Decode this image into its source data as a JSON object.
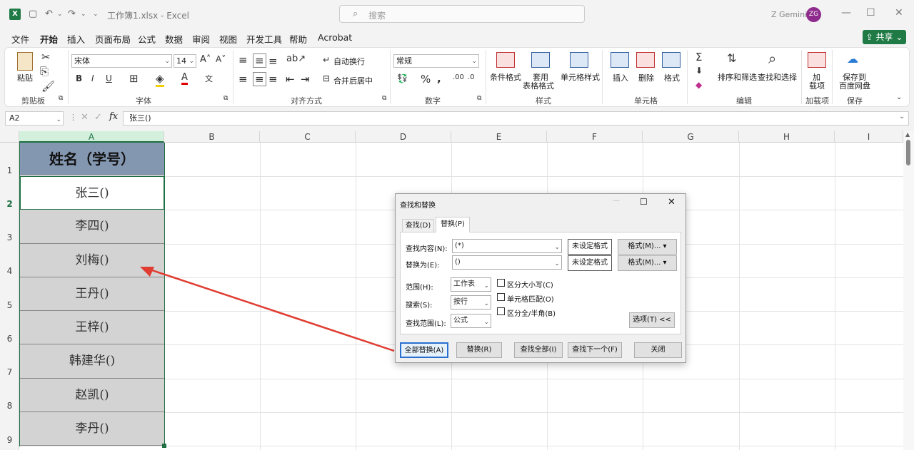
{
  "title_bar": {
    "file_title": "工作簿1.xlsx - Excel",
    "search_placeholder": "搜索",
    "user_name": "Z Gemini",
    "avatar_initials": "ZG"
  },
  "menu": {
    "items": [
      "文件",
      "开始",
      "插入",
      "页面布局",
      "公式",
      "数据",
      "审阅",
      "视图",
      "开发工具",
      "帮助",
      "Acrobat"
    ],
    "active": "开始",
    "share_label": "共享"
  },
  "ribbon": {
    "clipboard": {
      "paste": "粘贴",
      "label": "剪贴板"
    },
    "font": {
      "name": "宋体",
      "size": "14",
      "label": "字体"
    },
    "alignment": {
      "wrap": "自动换行",
      "merge": "合并后居中",
      "label": "对齐方式"
    },
    "number": {
      "format": "常规",
      "label": "数字"
    },
    "styles": {
      "conditional": "条件格式",
      "table_line1": "套用",
      "table_line2": "表格格式",
      "cell_styles": "单元格样式",
      "label": "样式"
    },
    "cells": {
      "insert": "插入",
      "delete": "删除",
      "format": "格式",
      "label": "单元格"
    },
    "editing": {
      "sort": "排序和筛选",
      "find": "查找和选择",
      "label": "编辑"
    },
    "addins": {
      "line1": "加",
      "line2": "载项",
      "label": "加载项"
    },
    "save": {
      "line1": "保存到",
      "line2": "百度网盘",
      "label": "保存"
    }
  },
  "formula_bar": {
    "name_box": "A2",
    "formula": "张三()"
  },
  "columns": [
    "A",
    "B",
    "C",
    "D",
    "E",
    "F",
    "G",
    "H",
    "I"
  ],
  "rows": [
    "1",
    "2",
    "3",
    "4",
    "5",
    "6",
    "7",
    "8",
    "9"
  ],
  "column_a": [
    "姓名（学号）",
    "张三()",
    "李四()",
    "刘梅()",
    "王丹()",
    "王梓()",
    "韩建华()",
    "赵凯()",
    "李丹()"
  ],
  "dialog": {
    "title": "查找和替换",
    "tab_find": "查找(D)",
    "tab_replace": "替换(P)",
    "find_label": "查找内容(N):",
    "find_value": "(*)",
    "replace_label": "替换为(E):",
    "replace_value": "()",
    "no_format": "未设定格式",
    "format_btn": "格式(M)...",
    "scope_label": "范围(H):",
    "scope_value": "工作表",
    "search_label": "搜索(S):",
    "search_value": "按行",
    "lookin_label": "查找范围(L):",
    "lookin_value": "公式",
    "opt_case": "区分大小写(C)",
    "opt_cell": "单元格匹配(O)",
    "opt_width": "区分全/半角(B)",
    "options_btn": "选项(T) <<",
    "replace_all": "全部替换(A)",
    "replace": "替换(R)",
    "find_all": "查找全部(I)",
    "find_next": "查找下一个(F)",
    "close": "关闭"
  },
  "colors": {
    "accent": "#1f7a45",
    "header_fill": "#8497b0",
    "cell_fill": "#d3d3d3",
    "arrow": "#e03c31"
  }
}
